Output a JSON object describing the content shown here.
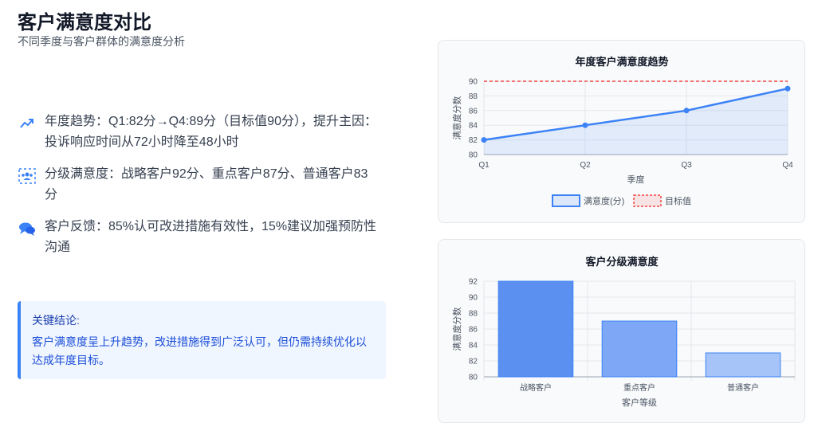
{
  "header": {
    "title": "客户满意度对比",
    "subtitle": "不同季度与客户群体的满意度分析"
  },
  "insights": [
    {
      "icon": "trend-up-icon",
      "text": "年度趋势：Q1:82分→Q4:89分（目标值90分），提升主因：投诉响应时间从72小时降至48小时"
    },
    {
      "icon": "users-icon",
      "text": "分级满意度：战略客户92分、重点客户87分、普通客户83分"
    },
    {
      "icon": "comments-icon",
      "text": "客户反馈：85%认可改进措施有效性，15%建议加强预防性沟通"
    }
  ],
  "conclusion": {
    "title": "关键结论:",
    "body": "客户满意度呈上升趋势，改进措施得到广泛认可，但仍需持续优化以达成年度目标。"
  },
  "colors": {
    "accent": "#3b82f6",
    "target_line": "#ef4444",
    "bar_strong": "#5b8ff0",
    "bar_mid": "#7ea8f5",
    "bar_light": "#a6c4f8"
  },
  "chart_data": [
    {
      "type": "line",
      "title": "年度客户满意度趋势",
      "xlabel": "季度",
      "ylabel": "满意度分数",
      "categories": [
        "Q1",
        "Q2",
        "Q3",
        "Q4"
      ],
      "series": [
        {
          "name": "满意度(分)",
          "values": [
            82,
            84,
            86,
            89
          ]
        },
        {
          "name": "目标值",
          "values": [
            90,
            90,
            90,
            90
          ]
        }
      ],
      "ylim": [
        80,
        90
      ],
      "yticks": [
        80,
        82,
        84,
        86,
        88,
        90
      ],
      "legend": "bottom",
      "grid": true
    },
    {
      "type": "bar",
      "title": "客户分级满意度",
      "xlabel": "客户等级",
      "ylabel": "满意度分数",
      "categories": [
        "战略客户",
        "重点客户",
        "普通客户"
      ],
      "values": [
        92,
        87,
        83
      ],
      "ylim": [
        80,
        92
      ],
      "yticks": [
        80,
        82,
        84,
        86,
        88,
        90,
        92
      ],
      "grid": true
    }
  ]
}
